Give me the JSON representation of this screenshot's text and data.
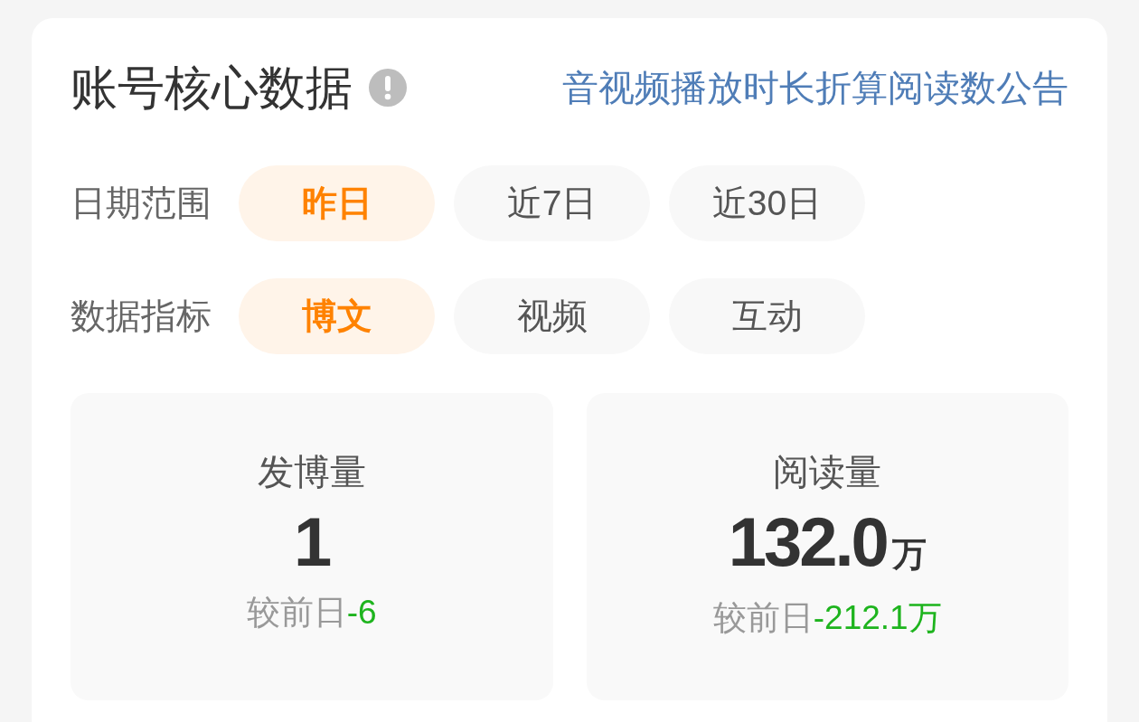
{
  "header": {
    "title": "账号核心数据",
    "notice_link": "音视频播放时长折算阅读数公告"
  },
  "filters": [
    {
      "label": "日期范围",
      "options": [
        {
          "label": "昨日",
          "selected": true
        },
        {
          "label": "近7日",
          "selected": false
        },
        {
          "label": "近30日",
          "selected": false
        }
      ]
    },
    {
      "label": "数据指标",
      "options": [
        {
          "label": "博文",
          "selected": true
        },
        {
          "label": "视频",
          "selected": false
        },
        {
          "label": "互动",
          "selected": false
        }
      ]
    }
  ],
  "stats": [
    {
      "label": "发博量",
      "value": "1",
      "delta_label": "较前日",
      "delta_value": "-6"
    },
    {
      "label": "阅读量",
      "value": "132.0",
      "unit": "万",
      "delta_label": "较前日",
      "delta_value": "-212.1万"
    }
  ]
}
